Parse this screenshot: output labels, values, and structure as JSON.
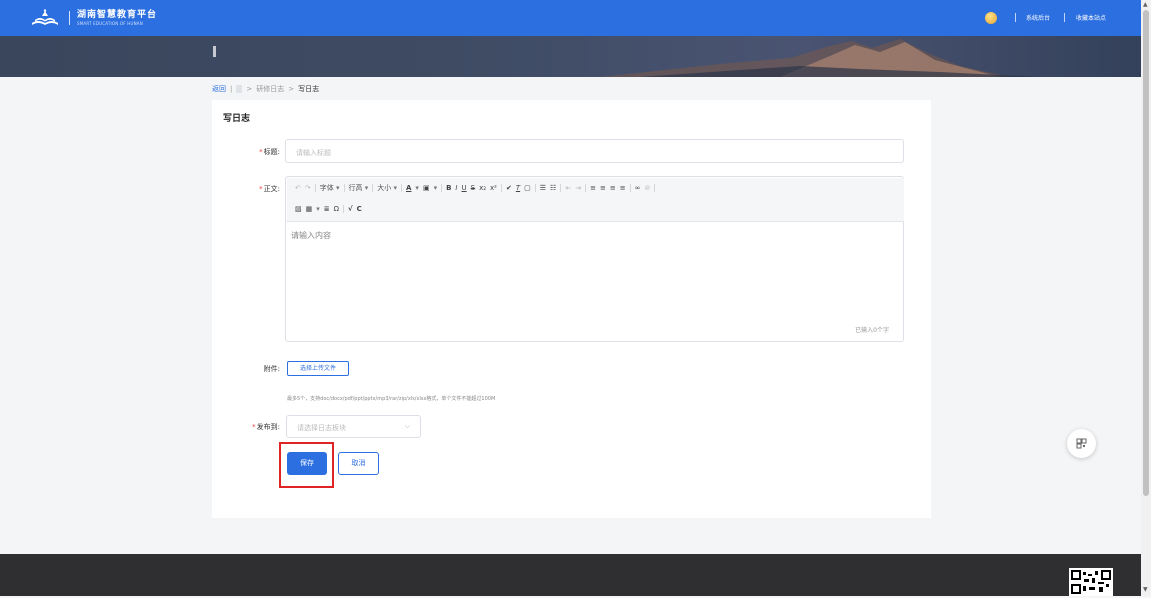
{
  "header": {
    "brand_title": "湖南智慧教育平台",
    "brand_subtitle": "SMART EDUCATION OF HUNAN",
    "links": [
      "系统后台",
      "收藏本站点"
    ]
  },
  "breadcrumb": {
    "back": "返回",
    "parent": "研修日志",
    "current": "写日志"
  },
  "form": {
    "heading": "写日志",
    "title_label": "标题:",
    "title_placeholder": "请输入标题",
    "body_label": "正文:",
    "editor_placeholder": "请输入内容",
    "char_count": "已输入0个字",
    "attachment_label": "附件:",
    "upload_button": "选择上传文件",
    "upload_hint": "最多5个，支持doc/docx/pdf/ppt/pptx/mp3/rar/zip/xls/xlsx格式，单个文件不能超过100M",
    "publish_label": "发布到:",
    "publish_placeholder": "请选择日志板块",
    "save_button": "保存",
    "cancel_button": "取消"
  },
  "toolbar": {
    "font": "字体",
    "line_height": "行高",
    "size": "大小"
  },
  "colors": {
    "primary": "#2c6fe0",
    "highlight": "#e02424",
    "footer": "#2f2f31"
  }
}
